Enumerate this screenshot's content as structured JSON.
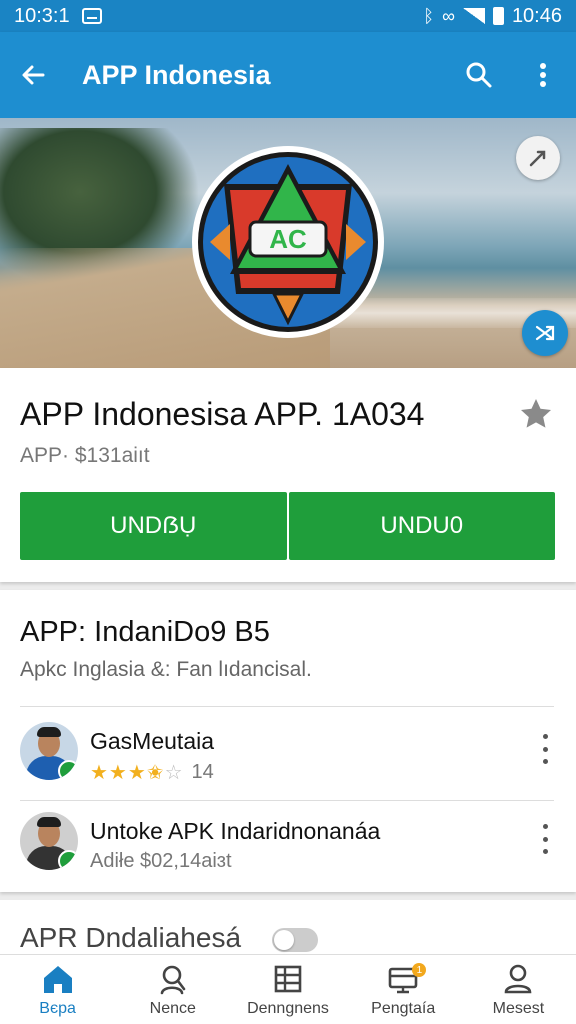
{
  "status_bar": {
    "time_left": "10:3:1",
    "time_right": "10:46"
  },
  "app_bar": {
    "title": "APP Indonesia",
    "back_icon": "arrow-left-icon",
    "search_icon": "search-icon",
    "menu_icon": "more-vert-icon"
  },
  "hero": {
    "logo_text": "AC",
    "top_action_icon": "edit-icon",
    "bottom_action_icon": "shuffle-icon",
    "accent": "#1e8ed0"
  },
  "app_card": {
    "title": "APP Indonesisa APP. 1A034",
    "meta": "APP· $131aiıt",
    "buttons": [
      "UNDẞỤ",
      "UNDU0"
    ],
    "button_color": "#1f9e3b"
  },
  "section": {
    "title": "APP: IndaniDo9 B5",
    "subtitle": "Apkc Inglasia &: Fan lıdancisal.",
    "items": [
      {
        "name": "GasMeutaia",
        "rating": 3.5,
        "rating_text": "14",
        "suit_color": "#1e5fb0"
      },
      {
        "name": "Untoke APK Indaridnonanáa",
        "detail": "Adiłe  $02,14aiɜt",
        "suit_color": "#333333"
      }
    ]
  },
  "next_section": {
    "title": "APR Dndaliahesá"
  },
  "bottom_nav": [
    {
      "label": "Bєpa",
      "icon": "home-icon",
      "active": true
    },
    {
      "label": "Nence",
      "icon": "person-icon",
      "active": false
    },
    {
      "label": "Denngnens",
      "icon": "grid-icon",
      "active": false
    },
    {
      "label": "Pengtaía",
      "icon": "inbox-icon",
      "active": false,
      "badge": "1"
    },
    {
      "label": "Mesest",
      "icon": "account-icon",
      "active": false
    }
  ]
}
